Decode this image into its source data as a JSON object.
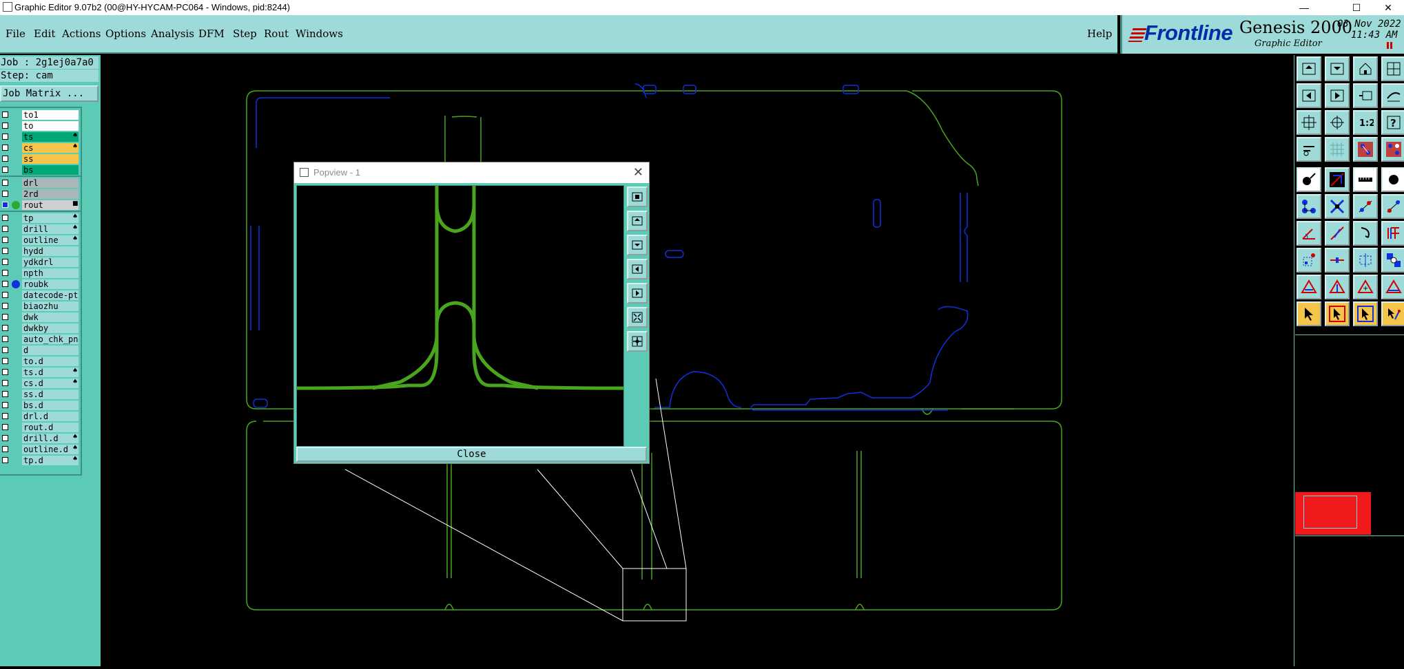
{
  "window": {
    "title": "Graphic Editor 9.07b2 (00@HY-HYCAM-PC064 - Windows, pid:8244)",
    "minimize": "—",
    "maximize": "☐",
    "close": "✕"
  },
  "menu": {
    "items": [
      "File",
      "Edit",
      "Actions",
      "Options",
      "Analysis",
      "DFM",
      "Step",
      "Rout",
      "Windows"
    ],
    "help": "Help"
  },
  "brand": {
    "logo": "Frontline",
    "product": "Genesis 2000",
    "subtitle": "Graphic Editor",
    "date": "03 Nov 2022",
    "time": "11:43 AM"
  },
  "job": {
    "job_line": "Job : 2g1ej0a7a0",
    "step_line": "Step: cam",
    "matrix_button": "Job Matrix ..."
  },
  "layers": {
    "items": [
      {
        "name": "to1",
        "color": "#ffffff"
      },
      {
        "name": "to",
        "color": "#ffffff"
      },
      {
        "name": "ts",
        "color": "#00a878",
        "mark": "♠"
      },
      {
        "name": "cs",
        "color": "#f5c44a",
        "mark": "♠"
      },
      {
        "name": "ss",
        "color": "#f5c44a"
      },
      {
        "name": "bs",
        "color": "#00a878"
      },
      {
        "name": "drl",
        "color": "#a8b8b8"
      },
      {
        "name": "2rd",
        "color": "#a8b8b8"
      },
      {
        "name": "rout",
        "color": "#d0d0d0",
        "dot": "#2ea82e",
        "mark": "■"
      },
      {
        "name": "tp",
        "color": "#9edbd8",
        "mark": "♠"
      },
      {
        "name": "drill",
        "color": "#9edbd8",
        "mark": "♠"
      },
      {
        "name": "outline",
        "color": "#9edbd8",
        "mark": "♠"
      },
      {
        "name": "hydd",
        "color": "#9edbd8"
      },
      {
        "name": "ydkdrl",
        "color": "#9edbd8"
      },
      {
        "name": "npth",
        "color": "#9edbd8"
      },
      {
        "name": "roubk",
        "color": "#9edbd8",
        "dot": "#1030e0"
      },
      {
        "name": "datecode-pte",
        "color": "#9edbd8"
      },
      {
        "name": "biaozhu",
        "color": "#9edbd8"
      },
      {
        "name": "dwk",
        "color": "#9edbd8"
      },
      {
        "name": "dwkby",
        "color": "#9edbd8"
      },
      {
        "name": "auto_chk_pn",
        "color": "#9edbd8"
      },
      {
        "name": "d",
        "color": "#9edbd8"
      },
      {
        "name": "to.d",
        "color": "#9edbd8"
      },
      {
        "name": "ts.d",
        "color": "#9edbd8",
        "mark": "♠"
      },
      {
        "name": "cs.d",
        "color": "#9edbd8",
        "mark": "♠"
      },
      {
        "name": "ss.d",
        "color": "#9edbd8"
      },
      {
        "name": "bs.d",
        "color": "#9edbd8"
      },
      {
        "name": "drl.d",
        "color": "#9edbd8"
      },
      {
        "name": "rout.d",
        "color": "#9edbd8"
      },
      {
        "name": "drill.d",
        "color": "#9edbd8",
        "mark": "♠"
      },
      {
        "name": "outline.d",
        "color": "#9edbd8",
        "mark": "♠"
      },
      {
        "name": "tp.d",
        "color": "#9edbd8",
        "mark": "♠"
      }
    ]
  },
  "popview": {
    "title": "Popview - 1",
    "close_label": "Close"
  },
  "colors": {
    "panel": "#5ccbb5",
    "light_panel": "#9edbd8",
    "rout_green": "#4aa51e",
    "roubk_blue": "#1030e0",
    "overview_red": "#f01a1a"
  },
  "toolbar": {
    "icons": [
      "zoom-home-icon",
      "zoom-in-icon",
      "home-icon",
      "split-view-icon",
      "pan-left-icon",
      "pan-right-icon",
      "zoom-back-icon",
      "measure-icon",
      "zoom-fit-icon",
      "zoom-area-icon",
      "ratio-icon",
      "help-icon",
      "snap-icon",
      "grid-icon",
      "layer-compare-icon",
      "drc-icon",
      "add-pad-icon",
      "line-cross-icon",
      "ruler-icon",
      "dot-icon",
      "connect-icon",
      "intersect-icon",
      "node-icon",
      "slant-node-icon",
      "angle-icon",
      "line-slope-icon",
      "arc-icon",
      "fence-icon",
      "snap-box-icon",
      "dash-icon",
      "bracket-icon",
      "net-icon",
      "tri-icon",
      "tri-arrow-icon",
      "tri-plus-icon",
      "tri-bar-icon",
      "select-arrow-icon",
      "select-box-icon",
      "select-multi-icon",
      "select-path-icon"
    ]
  }
}
